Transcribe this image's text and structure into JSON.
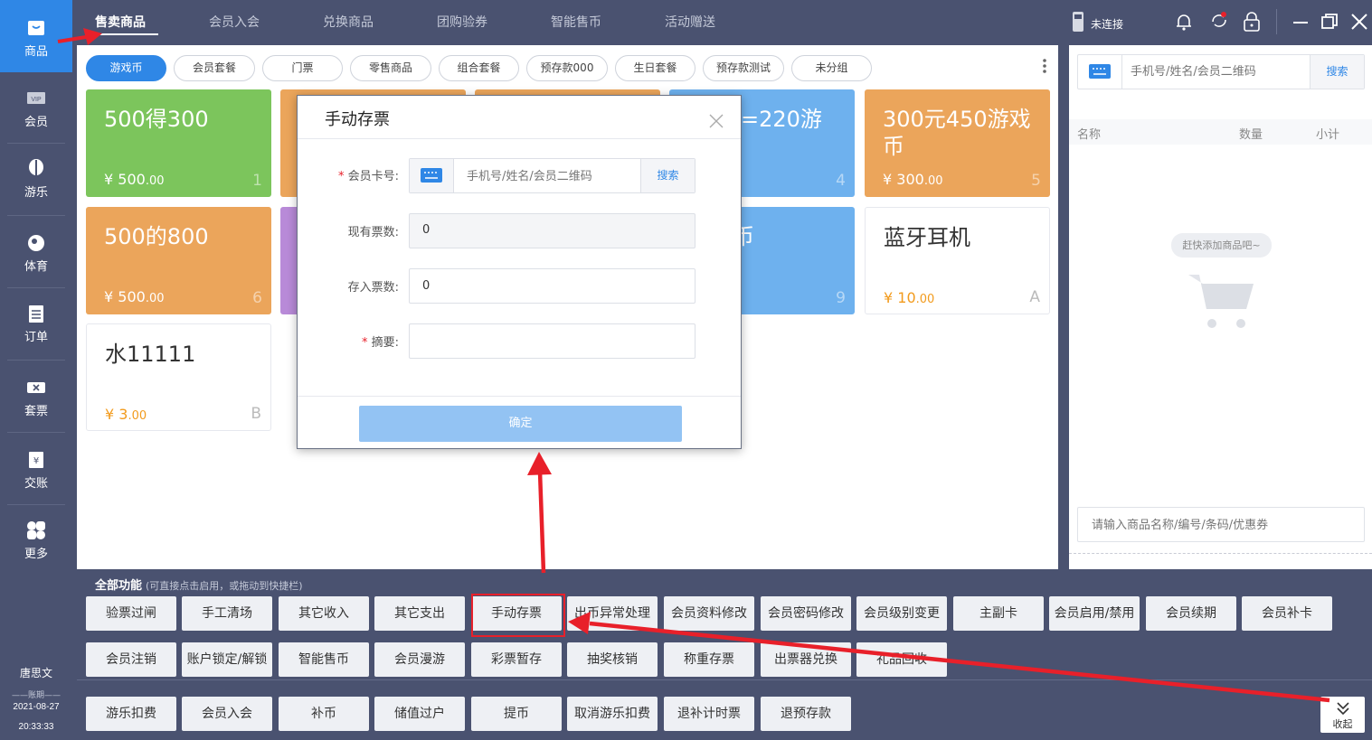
{
  "sidebar": {
    "items": [
      {
        "label": "商品",
        "icon": "shopping-bag-icon"
      },
      {
        "label": "会员",
        "icon": "vip-icon"
      },
      {
        "label": "游乐",
        "icon": "balloon-icon"
      },
      {
        "label": "体育",
        "icon": "ball-icon"
      },
      {
        "label": "订单",
        "icon": "clipboard-icon"
      },
      {
        "label": "套票",
        "icon": "ticket-icon"
      },
      {
        "label": "交账",
        "icon": "yuan-receipt-icon"
      },
      {
        "label": "更多",
        "icon": "grid-more-icon"
      }
    ],
    "user": "唐思文",
    "period_label": "账期",
    "date": "2021-08-27",
    "time": "20:33:33"
  },
  "tabs": [
    "售卖商品",
    "会员入会",
    "兑换商品",
    "团购验券",
    "智能售币",
    "活动赠送"
  ],
  "header": {
    "device_status": "未连接"
  },
  "chips": [
    "游戏币",
    "会员套餐",
    "门票",
    "零售商品",
    "组合套餐",
    "预存款000",
    "生日套餐",
    "预存款测试",
    "未分组"
  ],
  "cards": [
    {
      "name": "500得300",
      "price": "¥ 500",
      "cents": ".00",
      "key": "1"
    },
    {
      "name": "元=220游",
      "price": "",
      "cents": "",
      "key": "4"
    },
    {
      "name": "300元450游戏币",
      "price": "¥ 300",
      "cents": ".00",
      "key": "5"
    },
    {
      "name": "500的800",
      "price": "¥ 500",
      "cents": ".00",
      "key": "6"
    },
    {
      "name": "币",
      "price": "",
      "cents": "",
      "key": "9"
    },
    {
      "name": "蓝牙耳机",
      "price": "¥ 10",
      "cents": ".00",
      "key": "A"
    },
    {
      "name": "水11111",
      "price": "¥ 3",
      "cents": ".00",
      "key": "B"
    }
  ],
  "right_panel": {
    "search_placeholder": "手机号/姓名/会员二维码",
    "search_button": "搜索",
    "col_name": "名称",
    "col_qty": "数量",
    "col_subtotal": "小计",
    "empty_hint": "赶快添加商品吧~",
    "product_placeholder": "请输入商品名称/编号/条码/优惠券"
  },
  "modal": {
    "title": "手动存票",
    "card_label": "会员卡号:",
    "card_placeholder": "手机号/姓名/会员二维码",
    "search_button": "搜索",
    "current_label": "现有票数:",
    "current_value": "0",
    "deposit_label": "存入票数:",
    "deposit_value": "0",
    "memo_label": "摘要:",
    "memo_value": "",
    "confirm": "确定"
  },
  "functions": {
    "title": "全部功能",
    "hint": "(可直接点击启用，或拖动到快捷栏)",
    "row1": [
      "验票过闸",
      "手工清场",
      "其它收入",
      "其它支出",
      "手动存票",
      "出币异常处理",
      "会员资料修改",
      "会员密码修改",
      "会员级别变更",
      "主副卡",
      "会员启用/禁用",
      "会员续期",
      "会员补卡"
    ],
    "row2": [
      "会员注销",
      "账户锁定/解锁",
      "智能售币",
      "会员漫游",
      "彩票暂存",
      "抽奖核销",
      "称重存票",
      "出票器兑换",
      "礼品回收"
    ],
    "quick": [
      "游乐扣费",
      "会员入会",
      "补币",
      "储值过户",
      "提币",
      "取消游乐扣费",
      "退补计时票",
      "退预存款"
    ],
    "collapse": "收起"
  },
  "colors": {
    "accent": "#2f87e6",
    "annotation": "#e8202a",
    "sidebar": "#4a5270"
  }
}
